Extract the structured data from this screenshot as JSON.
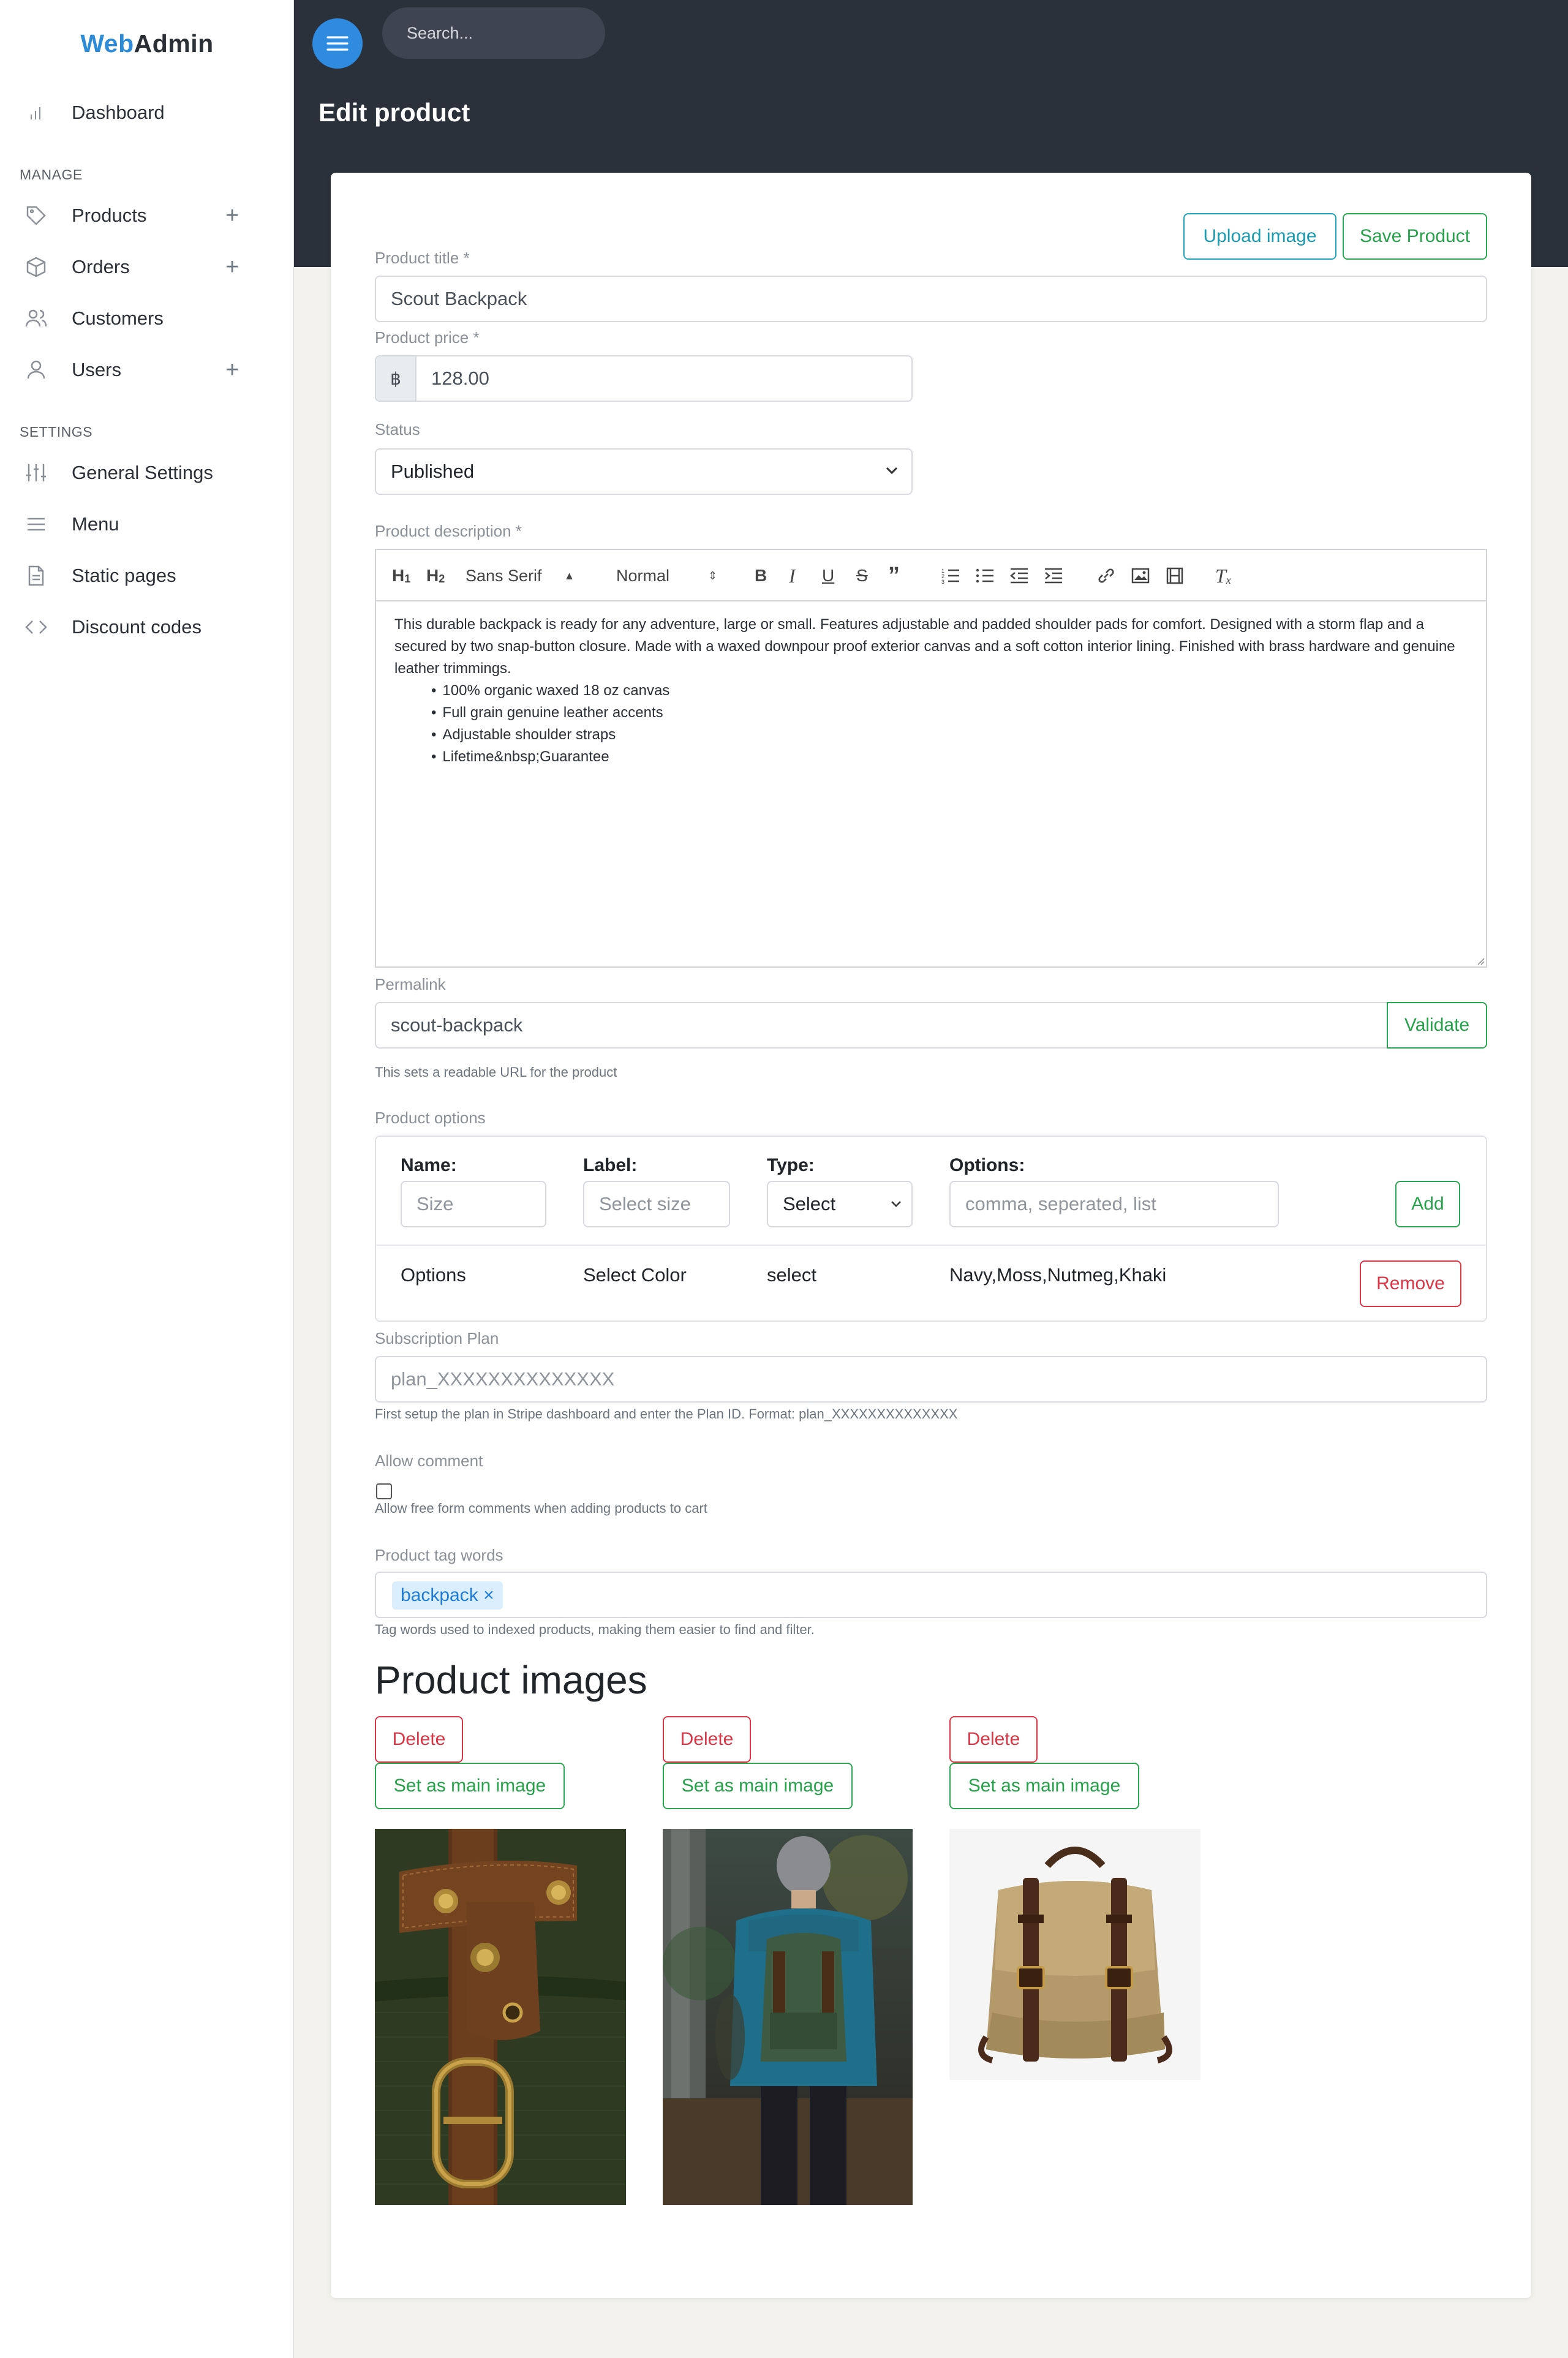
{
  "brand": {
    "part1": "Web",
    "part2": "Admin"
  },
  "sidebar": {
    "dashboard": "Dashboard",
    "manage_heading": "MANAGE",
    "settings_heading": "SETTINGS",
    "items": [
      {
        "label": "Products",
        "icon": "tag-icon"
      },
      {
        "label": "Orders",
        "icon": "box-icon"
      },
      {
        "label": "Customers",
        "icon": "users-icon"
      },
      {
        "label": "Users",
        "icon": "user-icon"
      },
      {
        "label": "General Settings",
        "icon": "sliders-icon"
      },
      {
        "label": "Menu",
        "icon": "menu-icon"
      },
      {
        "label": "Static pages",
        "icon": "file-icon"
      },
      {
        "label": "Discount codes",
        "icon": "code-icon"
      }
    ]
  },
  "header": {
    "search_placeholder": "Search...",
    "page_title": "Edit product"
  },
  "actions": {
    "upload": "Upload image",
    "save": "Save Product"
  },
  "form": {
    "title_label": "Product title *",
    "title_value": "Scout Backpack",
    "price_label": "Product price *",
    "currency": "฿",
    "price_value": "128.00",
    "status_label": "Status",
    "status_value": "Published",
    "description_label": "Product description *",
    "toolbar": {
      "font": "Sans Serif",
      "size": "Normal"
    },
    "description_text": "This durable backpack is ready for any adventure, large or small. Features adjustable and padded shoulder pads for comfort. Designed with a storm flap and a secured by two snap-button closure. Made with a waxed downpour proof exterior canvas and a soft cotton interior lining. Finished with brass hardware and genuine leather trimmings.",
    "description_bullets": [
      "100% organic waxed 18 oz canvas",
      "Full grain genuine leather accents",
      "Adjustable shoulder straps",
      "Lifetime&nbsp;Guarantee"
    ],
    "permalink_label": "Permalink",
    "permalink_value": "scout-backpack",
    "validate": "Validate",
    "permalink_help": "This sets a readable URL for the product",
    "options_label": "Product options",
    "options": {
      "name_head": "Name:",
      "label_head": "Label:",
      "type_head": "Type:",
      "options_head": "Options:",
      "name_placeholder": "Size",
      "label_placeholder": "Select size",
      "type_select": "Select",
      "options_placeholder": "comma, seperated, list",
      "add": "Add",
      "row": {
        "name": "Options",
        "label": "Select Color",
        "type": "select",
        "values": "Navy,Moss,Nutmeg,Khaki",
        "remove": "Remove"
      }
    },
    "subscription_label": "Subscription Plan",
    "subscription_placeholder": "plan_XXXXXXXXXXXXXX",
    "subscription_help": "First setup the plan in Stripe dashboard and enter the Plan ID. Format: plan_XXXXXXXXXXXXXX",
    "comment_label": "Allow comment",
    "comment_help": "Allow free form comments when adding products to cart",
    "tags_label": "Product tag words",
    "tag": "backpack ×",
    "tags_help": "Tag words used to indexed products, making them easier to find and filter."
  },
  "images": {
    "heading": "Product images",
    "delete": "Delete",
    "set_main": "Set as main image"
  },
  "colors": {
    "accent": "#2f8be0",
    "topbar": "#2b313a",
    "green": "#28a745",
    "red": "#dc3545",
    "teal": "#17a2b8"
  }
}
